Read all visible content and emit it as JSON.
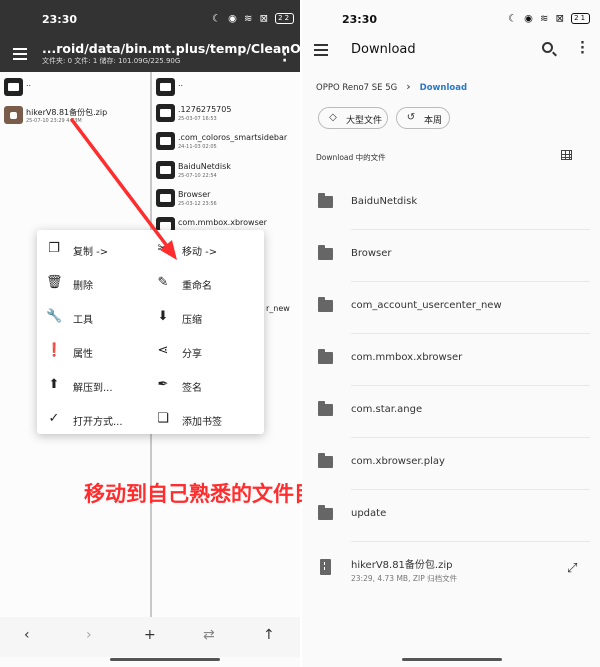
{
  "left": {
    "status": {
      "time": "23:30",
      "battery": "22"
    },
    "toolbar": {
      "path": "...roid/data/bin.mt.plus/temp/CleanOnExit/",
      "info": "文件夹: 0  文件: 1  储存: 101.09G/225.90G"
    },
    "left_pane": [
      {
        "name": "..",
        "meta": "",
        "kind": "folder"
      },
      {
        "name": "hikerV8.81备份包.zip",
        "meta": "25-07-10 23:29  4.73M",
        "kind": "zip"
      }
    ],
    "right_pane": [
      {
        "name": "..",
        "meta": ""
      },
      {
        "name": ".1276275705",
        "meta": "25-03-07 16:53"
      },
      {
        "name": ".com_coloros_smartsidebar",
        "meta": "24-11-03 02:05"
      },
      {
        "name": "BaiduNetdisk",
        "meta": "25-07-10 22:54"
      },
      {
        "name": "Browser",
        "meta": "25-03-12 23:56"
      },
      {
        "name": "com.mmbox.xbrowser",
        "meta": ""
      }
    ],
    "hidden_partial": "r_new",
    "menu": {
      "col1": [
        {
          "icon": "copy-icon",
          "label": "复制 ->"
        },
        {
          "icon": "trash-icon",
          "label": "删除"
        },
        {
          "icon": "wrench-icon",
          "label": "工具"
        },
        {
          "icon": "info-icon",
          "label": "属性"
        },
        {
          "icon": "extract-icon",
          "label": "解压到..."
        },
        {
          "icon": "check-icon",
          "label": "打开方式..."
        }
      ],
      "col2": [
        {
          "icon": "scissors-icon",
          "label": "移动 ->"
        },
        {
          "icon": "pencil-icon",
          "label": "重命名"
        },
        {
          "icon": "download-icon",
          "label": "压缩"
        },
        {
          "icon": "share-icon",
          "label": "分享"
        },
        {
          "icon": "sign-icon",
          "label": "签名"
        },
        {
          "icon": "bookmark-icon",
          "label": "添加书签"
        }
      ]
    },
    "annotation": "移动到自己熟悉的文件目录中",
    "bottom_nav": [
      "back-icon",
      "forward-icon",
      "add-icon",
      "swap-icon",
      "up-icon"
    ]
  },
  "right": {
    "status": {
      "time": "23:30",
      "battery": "21"
    },
    "header": {
      "title": "Download"
    },
    "breadcrumb": {
      "device": "OPPO Reno7 SE 5G",
      "current": "Download"
    },
    "chips": [
      "大型文件",
      "本周"
    ],
    "section_title": "Download 中的文件",
    "folders": [
      "BaiduNetdisk",
      "Browser",
      "com_account_usercenter_new",
      "com.mmbox.xbrowser",
      "com.star.ange",
      "com.xbrowser.play",
      "update"
    ],
    "file": {
      "name": "hikerV8.81备份包.zip",
      "meta": "23:29, 4.73 MB, ZIP 归档文件"
    }
  },
  "colors": {
    "annotation": "#ff2d2d",
    "link": "#2a79c8",
    "toolbar": "#333333"
  }
}
